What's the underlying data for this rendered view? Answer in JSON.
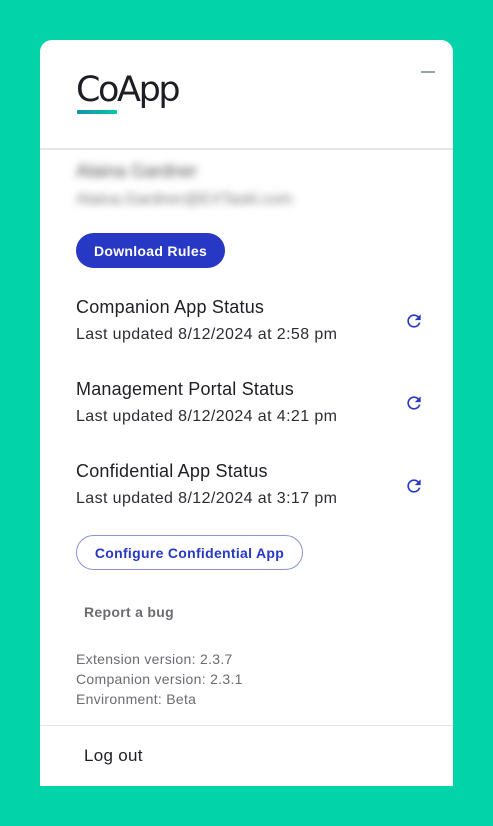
{
  "app": {
    "logo_text": "CoApp",
    "brand_colors": {
      "background": "#03d3a8",
      "primary": "#2638c4",
      "logo_gradient_start": "#1a8fb5",
      "logo_gradient_end": "#06c8a5"
    }
  },
  "header": {
    "minimize_icon": "minus-icon"
  },
  "user": {
    "name": "Alaina Gardner",
    "email": "Alaina.Gardner@EXTaskl.com"
  },
  "actions": {
    "download_rules_label": "Download Rules",
    "configure_label": "Configure Confidential App",
    "report_bug_label": "Report a bug"
  },
  "statuses": [
    {
      "title": "Companion App Status",
      "updated": "Last updated 8/12/2024 at 2:58 pm",
      "icon": "refresh-icon"
    },
    {
      "title": "Management Portal Status",
      "updated": "Last updated 8/12/2024 at 4:21 pm",
      "icon": "refresh-icon"
    },
    {
      "title": "Confidential App Status",
      "updated": "Last updated 8/12/2024 at 3:17 pm",
      "icon": "refresh-icon"
    }
  ],
  "versions": {
    "extension": "Extension version: 2.3.7",
    "companion": "Companion version: 2.3.1",
    "environment": "Environment: Beta"
  },
  "footer": {
    "logout_label": "Log out"
  }
}
